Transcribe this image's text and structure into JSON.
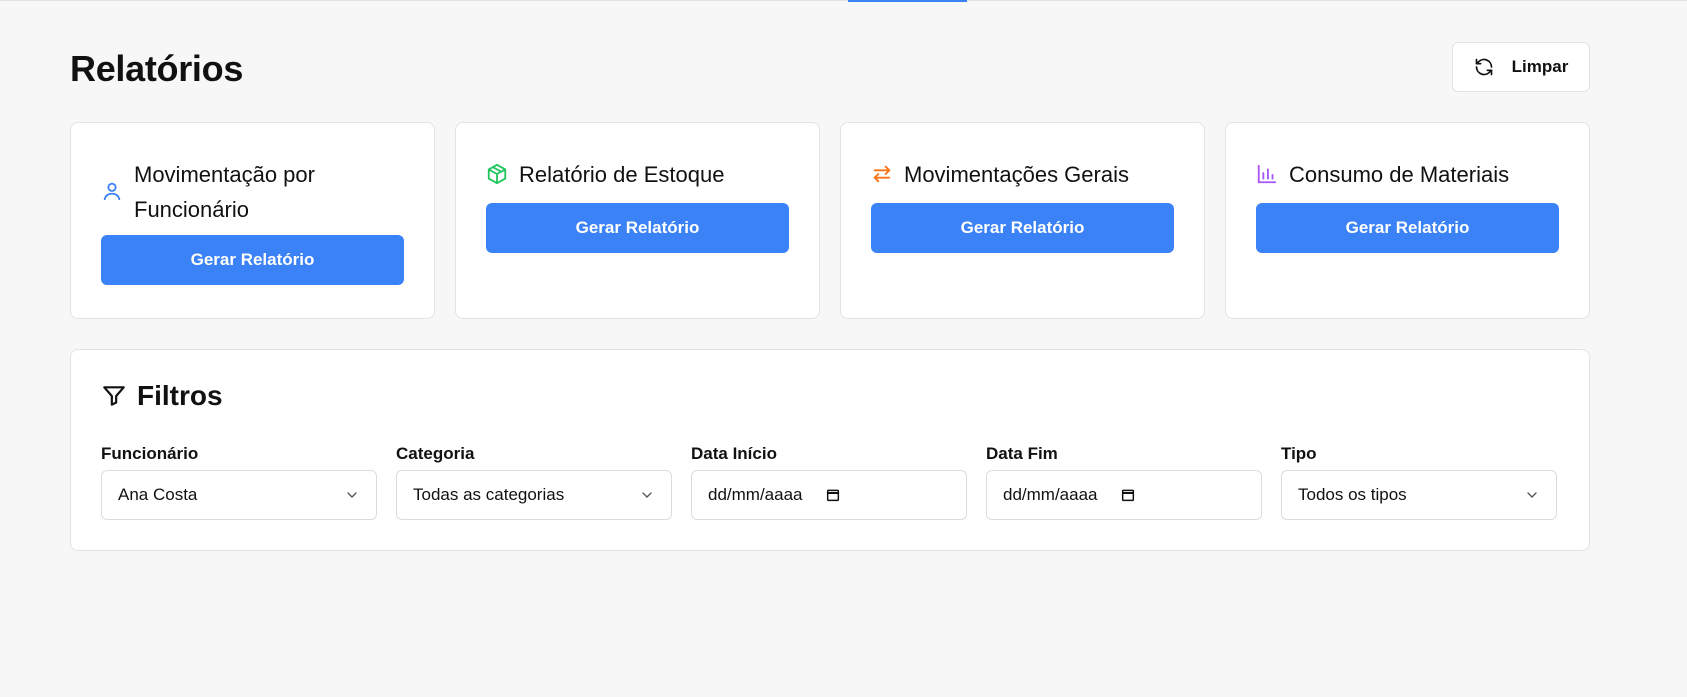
{
  "header": {
    "title": "Relatórios",
    "clear_label": "Limpar"
  },
  "cards": [
    {
      "title": "Movimentação por Funcionário",
      "icon": "user-icon",
      "icon_color": "#3b82f6",
      "button_label": "Gerar Relatório"
    },
    {
      "title": "Relatório de Estoque",
      "icon": "package-icon",
      "icon_color": "#22c55e",
      "button_label": "Gerar Relatório"
    },
    {
      "title": "Movimentações Gerais",
      "icon": "arrows-exchange-icon",
      "icon_color": "#f97316",
      "button_label": "Gerar Relatório"
    },
    {
      "title": "Consumo de Materiais",
      "icon": "bar-chart-icon",
      "icon_color": "#a855f7",
      "button_label": "Gerar Relatório"
    }
  ],
  "filters": {
    "title": "Filtros",
    "fields": [
      {
        "label": "Funcionário",
        "value": "Ana Costa",
        "type": "select"
      },
      {
        "label": "Categoria",
        "value": "Todas as categorias",
        "type": "select"
      },
      {
        "label": "Data Início",
        "value": "dd/mm/aaaa",
        "type": "date"
      },
      {
        "label": "Data Fim",
        "value": "dd/mm/aaaa",
        "type": "date"
      },
      {
        "label": "Tipo",
        "value": "Todos os tipos",
        "type": "select"
      }
    ]
  },
  "colors": {
    "accent": "#3b82f6",
    "background": "#f7f7f7"
  }
}
